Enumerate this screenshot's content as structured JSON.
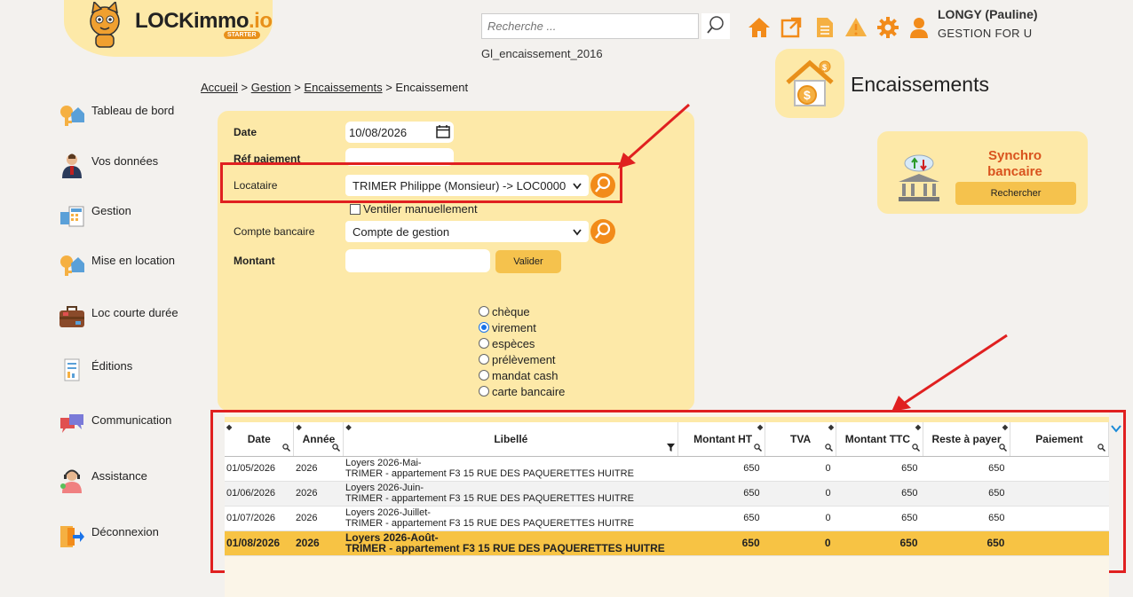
{
  "logo": {
    "brand_main": "LOCKimmo",
    "brand_suffix": ".io",
    "badge": "STARTER"
  },
  "header": {
    "search_placeholder": "Recherche ...",
    "file_label": "Gl_encaissement_2016",
    "icons": [
      "home-icon",
      "external-link-icon",
      "document-icon",
      "alert-icon",
      "gear-icon",
      "user-icon"
    ],
    "user_name": "LONGY (Pauline)",
    "user_company": "GESTION FOR U"
  },
  "breadcrumb": {
    "items": [
      "Accueil",
      "Gestion",
      "Encaissements"
    ],
    "current": "Encaissement",
    "separator": ">"
  },
  "page_title": "Encaissements",
  "sidebar": {
    "items": [
      {
        "label": "Tableau de bord",
        "icon": "keys-house-icon"
      },
      {
        "label": "Vos données",
        "icon": "person-icon"
      },
      {
        "label": "Gestion",
        "icon": "calculator-icon"
      },
      {
        "label": "Mise en location",
        "icon": "keys-house-icon"
      },
      {
        "label": "Loc courte durée",
        "icon": "suitcase-icon"
      },
      {
        "label": "Éditions",
        "icon": "report-icon"
      },
      {
        "label": "Communication",
        "icon": "chat-icon"
      },
      {
        "label": "Assistance",
        "icon": "support-agent-icon"
      },
      {
        "label": "Déconnexion",
        "icon": "logout-icon"
      }
    ]
  },
  "form": {
    "date_label": "Date",
    "date_value": "10/08/2026",
    "ref_label": "Réf paiement",
    "ref_value": "",
    "locataire_label": "Locataire",
    "locataire_value": "TRIMER Philippe (Monsieur) -> LOC0000",
    "ventiler_label": "Ventiler manuellement",
    "ventiler_checked": false,
    "compte_label": "Compte bancaire",
    "compte_value": "Compte de gestion",
    "montant_label": "Montant",
    "montant_value": "",
    "valider_label": "Valider",
    "payment_modes": [
      "chèque",
      "virement",
      "espèces",
      "prélèvement",
      "mandat cash",
      "carte bancaire"
    ],
    "payment_selected": "virement"
  },
  "synchro": {
    "title": "Synchro bancaire",
    "button_label": "Rechercher"
  },
  "table": {
    "columns": [
      "Date",
      "Année",
      "Libellé",
      "Montant HT",
      "TVA",
      "Montant TTC",
      "Reste à payer",
      "Paiement"
    ],
    "rows": [
      {
        "date": "01/05/2026",
        "annee": "2026",
        "lib1": "Loyers 2026-Mai-",
        "lib2": "TRIMER - appartement F3 15 RUE DES PAQUERETTES HUITRE",
        "ht": "650",
        "tva": "0",
        "ttc": "650",
        "reste": "650",
        "paiement": ""
      },
      {
        "date": "01/06/2026",
        "annee": "2026",
        "lib1": "Loyers 2026-Juin-",
        "lib2": "TRIMER - appartement F3 15 RUE DES PAQUERETTES HUITRE",
        "ht": "650",
        "tva": "0",
        "ttc": "650",
        "reste": "650",
        "paiement": ""
      },
      {
        "date": "01/07/2026",
        "annee": "2026",
        "lib1": "Loyers 2026-Juillet-",
        "lib2": "TRIMER - appartement F3 15 RUE DES PAQUERETTES HUITRE",
        "ht": "650",
        "tva": "0",
        "ttc": "650",
        "reste": "650",
        "paiement": ""
      },
      {
        "date": "01/08/2026",
        "annee": "2026",
        "lib1": "Loyers 2026-Août-",
        "lib2": "TRIMER - appartement F3 15 RUE DES PAQUERETTES HUITRE",
        "ht": "650",
        "tva": "0",
        "ttc": "650",
        "reste": "650",
        "paiement": ""
      }
    ]
  },
  "colors": {
    "accent_yellow": "#fde9a8",
    "button_yellow": "#f5c24d",
    "orange": "#f28b1a",
    "highlight_row": "#f7c344",
    "annotation_red": "#e02020"
  }
}
